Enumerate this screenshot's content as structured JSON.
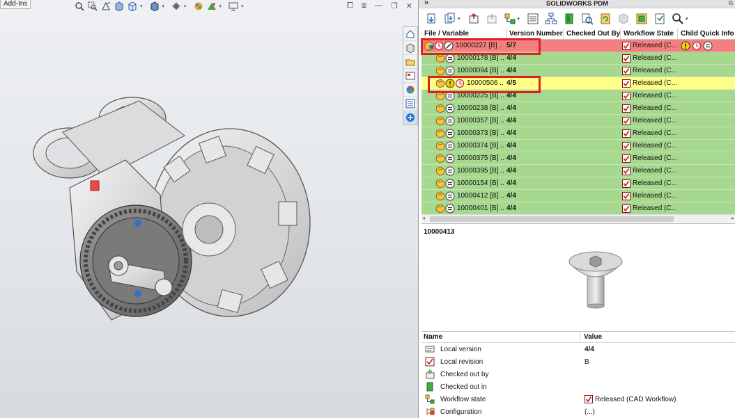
{
  "viewport": {
    "tab_label": "Add-Ins"
  },
  "pdm": {
    "title": "SOLIDWORKS PDM",
    "collapse_label": "»",
    "columns": [
      "File / Variable",
      "Version Number",
      "Checked Out By",
      "Workflow State",
      "Child Quick Info"
    ],
    "rows": [
      {
        "file": "10000227  [B]  ..",
        "version": "5/7",
        "checked_out_by": "",
        "state": "Released (C...",
        "style": "top",
        "indent": 0,
        "icons": [
          "assembly",
          "clock",
          "edit"
        ],
        "quick_info": [
          "warning",
          "clock",
          "equal"
        ]
      },
      {
        "file": "10000178  [B]  ..",
        "version": "4/4",
        "checked_out_by": "",
        "state": "Released (C...",
        "style": "ok",
        "indent": 1,
        "icons": [
          "part",
          "equal"
        ],
        "quick_info": []
      },
      {
        "file": "10000094  [B]  ..",
        "version": "4/4",
        "checked_out_by": "",
        "state": "Released (C...",
        "style": "ok",
        "indent": 1,
        "icons": [
          "part",
          "equal"
        ],
        "quick_info": []
      },
      {
        "file": "10000506 ..",
        "version": "4/5",
        "checked_out_by": "",
        "state": "Released (C...",
        "style": "warn",
        "indent": 1,
        "icons": [
          "part",
          "warning",
          "clock"
        ],
        "quick_info": []
      },
      {
        "file": "10000225  [B]  ..",
        "version": "4/4",
        "checked_out_by": "",
        "state": "Released (C...",
        "style": "ok",
        "indent": 1,
        "icons": [
          "part",
          "equal"
        ],
        "quick_info": []
      },
      {
        "file": "10000238  [B]  ..",
        "version": "4/4",
        "checked_out_by": "",
        "state": "Released (C...",
        "style": "ok",
        "indent": 1,
        "icons": [
          "part",
          "equal"
        ],
        "quick_info": []
      },
      {
        "file": "10000357  [B]  ..",
        "version": "4/4",
        "checked_out_by": "",
        "state": "Released (C...",
        "style": "ok",
        "indent": 1,
        "icons": [
          "part",
          "equal"
        ],
        "quick_info": []
      },
      {
        "file": "10000373  [B]  ..",
        "version": "4/4",
        "checked_out_by": "",
        "state": "Released (C...",
        "style": "ok",
        "indent": 1,
        "icons": [
          "part",
          "equal"
        ],
        "quick_info": []
      },
      {
        "file": "10000374  [B]  ..",
        "version": "4/4",
        "checked_out_by": "",
        "state": "Released (C...",
        "style": "ok",
        "indent": 1,
        "icons": [
          "part",
          "equal"
        ],
        "quick_info": []
      },
      {
        "file": "10000375  [B]  ..",
        "version": "4/4",
        "checked_out_by": "",
        "state": "Released (C...",
        "style": "ok",
        "indent": 1,
        "icons": [
          "part",
          "equal"
        ],
        "quick_info": []
      },
      {
        "file": "10000395  [B]  ..",
        "version": "4/4",
        "checked_out_by": "",
        "state": "Released (C...",
        "style": "ok",
        "indent": 1,
        "icons": [
          "part",
          "equal"
        ],
        "quick_info": []
      },
      {
        "file": "10000154  [B]  ..",
        "version": "4/4",
        "checked_out_by": "",
        "state": "Released (C...",
        "style": "ok",
        "indent": 1,
        "icons": [
          "part",
          "equal"
        ],
        "quick_info": []
      },
      {
        "file": "10000412  [B]  ..",
        "version": "4/4",
        "checked_out_by": "",
        "state": "Released (C...",
        "style": "ok",
        "indent": 1,
        "icons": [
          "part",
          "equal"
        ],
        "quick_info": []
      },
      {
        "file": "10000401  [B]  ..",
        "version": "4/4",
        "checked_out_by": "",
        "state": "Released (C...",
        "style": "ok",
        "indent": 1,
        "icons": [
          "part",
          "equal"
        ],
        "quick_info": []
      }
    ],
    "preview_title": "10000413",
    "props_columns": {
      "name": "Name",
      "value": "Value"
    },
    "props": [
      {
        "name": "Local version",
        "value": "4/4",
        "icon": "local-version-icon",
        "bold": true,
        "checkbox": false
      },
      {
        "name": "Local revision",
        "value": "B",
        "icon": "revision-check-icon",
        "bold": false,
        "checkbox": false
      },
      {
        "name": "Checked out by",
        "value": "",
        "icon": "checkout-user-icon",
        "bold": false,
        "checkbox": false
      },
      {
        "name": "Checked out in",
        "value": "",
        "icon": "checkout-location-icon",
        "bold": false,
        "checkbox": false
      },
      {
        "name": "Workflow state",
        "value": "Released (CAD Workflow)",
        "icon": "workflow-icon",
        "bold": false,
        "checkbox": true
      },
      {
        "name": "Configuration",
        "value": "(...)",
        "icon": "configuration-icon",
        "bold": false,
        "checkbox": false
      }
    ]
  },
  "colors": {
    "row_ok": "#a7d88f",
    "row_top": "#f47f7f",
    "row_warn": "#ffff88",
    "highlight": "#e01e24"
  }
}
